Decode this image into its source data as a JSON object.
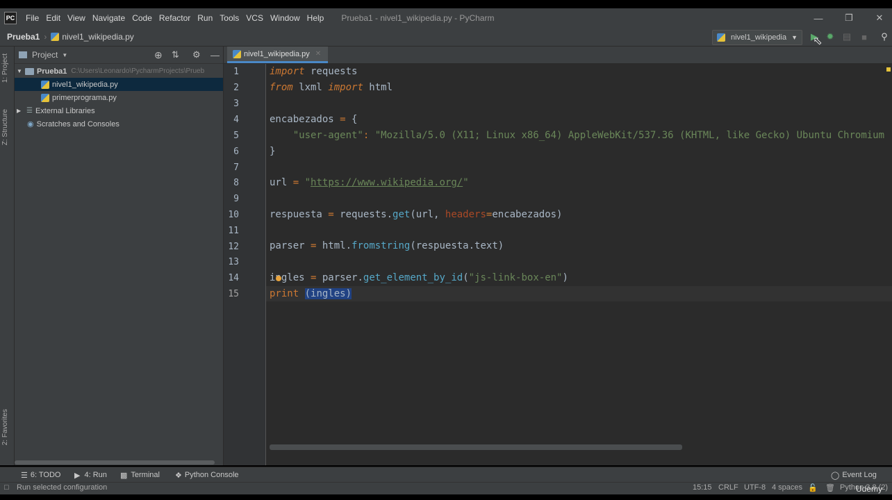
{
  "window": {
    "title": "Prueba1 - nivel1_wikipedia.py - PyCharm",
    "app_icon": "PC"
  },
  "menu": [
    "File",
    "Edit",
    "View",
    "Navigate",
    "Code",
    "Refactor",
    "Run",
    "Tools",
    "VCS",
    "Window",
    "Help"
  ],
  "breadcrumb": {
    "project": "Prueba1",
    "file": "nivel1_wikipedia.py"
  },
  "run_config": {
    "label": "nivel1_wikipedia"
  },
  "left_stripe": {
    "project": "1: Project",
    "structure": "Z: Structure",
    "favorites": "2: Favorites"
  },
  "project_panel": {
    "title": "Project",
    "tree": [
      {
        "label": "Prueba1",
        "path": "C:\\Users\\Leonardo\\PycharmProjects\\Prueb"
      },
      {
        "label": "nivel1_wikipedia.py"
      },
      {
        "label": "primerprograma.py"
      },
      {
        "label": "External Libraries"
      },
      {
        "label": "Scratches and Consoles"
      }
    ]
  },
  "editor": {
    "tab": "nivel1_wikipedia.py",
    "line_numbers": [
      "1",
      "2",
      "3",
      "4",
      "5",
      "6",
      "7",
      "8",
      "9",
      "10",
      "11",
      "12",
      "13",
      "14",
      "15"
    ],
    "lines": {
      "l1": {
        "kw": "import",
        "rest": " requests"
      },
      "l2": {
        "kw1": "from",
        "mid": " lxml ",
        "kw2": "import",
        "rest": " html"
      },
      "l4": {
        "name": "encabezados",
        "op": " = ",
        "brace": "{"
      },
      "l5": {
        "indent": "    ",
        "key": "\"user-agent\"",
        "colon": ": ",
        "val": "\"Mozilla/5.0 (X11; Linux x86_64) AppleWebKit/537.36 (KHTML, like Gecko) Ubuntu Chromium"
      },
      "l6": {
        "brace": "}"
      },
      "l8": {
        "name": "url",
        "op": " = ",
        "q1": "\"",
        "url": "https://www.wikipedia.org/",
        "q2": "\""
      },
      "l10": {
        "name": "respuesta",
        "op": " = ",
        "obj": "requests.",
        "fn": "get",
        "args1": "(url, ",
        "param": "headers",
        "eq": "=",
        "args2": "encabezados)"
      },
      "l12": {
        "name": "parser",
        "op": " = ",
        "obj": "html.",
        "fn": "fromstring",
        "args": "(respuesta.text)"
      },
      "l14": {
        "name": "ingles",
        "op": " = ",
        "obj": "parser.",
        "fn": "get_element_by_id",
        "p1": "(",
        "str": "\"js-link-box-en\"",
        "p2": ")"
      },
      "l15": {
        "kw": "print",
        "sp": " ",
        "args": "(ingles)"
      }
    }
  },
  "tool_tabs": {
    "todo": "6: TODO",
    "run": "4: Run",
    "terminal": "Terminal",
    "python_console": "Python Console",
    "event_log": "Event Log"
  },
  "status": {
    "message": "Run selected configuration",
    "position": "15:15",
    "line_sep": "CRLF",
    "encoding": "UTF-8",
    "indent": "4 spaces",
    "interpreter": "Python 3.8 (2)",
    "watermark": "Udemy"
  }
}
